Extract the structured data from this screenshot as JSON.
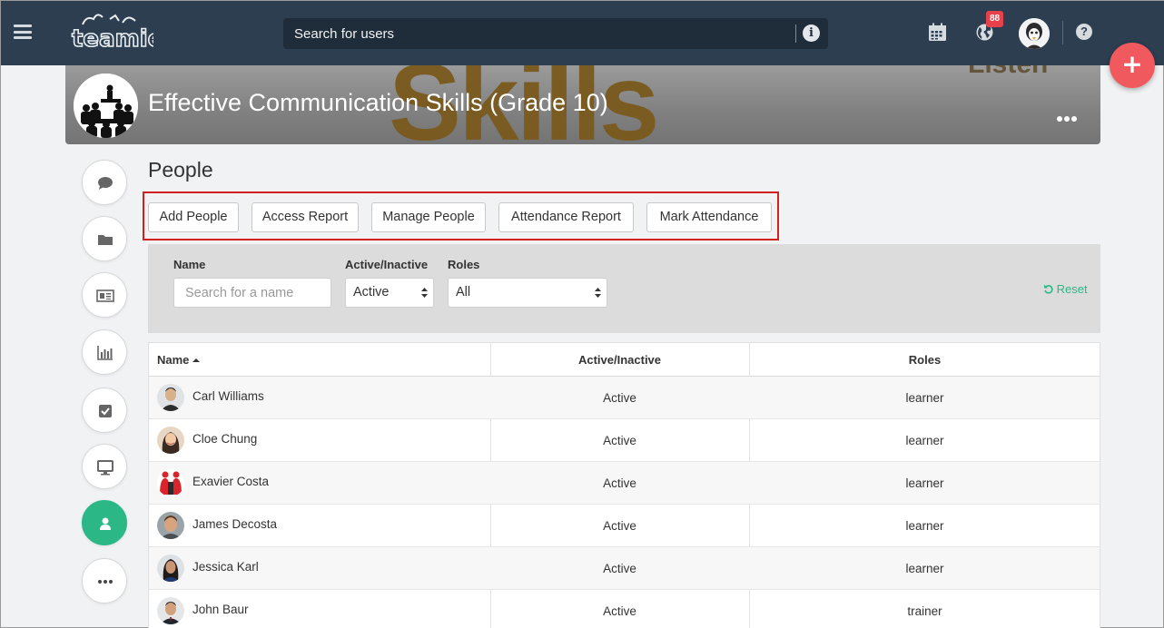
{
  "topbar": {
    "logo_text": "teamie",
    "search_placeholder": "Search for users",
    "notification_count": "88",
    "icons": [
      "hamburger-icon",
      "calendar-icon",
      "globe-icon",
      "info-icon",
      "help-icon",
      "plus-icon"
    ]
  },
  "banner": {
    "course_title": "Effective Communication Skills (Grade 10)",
    "bg_word": "Skills",
    "bg_word2": "Listen"
  },
  "sidebar": {
    "items": [
      {
        "name": "discussion",
        "icon": "chat-icon"
      },
      {
        "name": "files",
        "icon": "folder-icon"
      },
      {
        "name": "lessons",
        "icon": "newspaper-icon"
      },
      {
        "name": "gradebook",
        "icon": "bar-chart-icon"
      },
      {
        "name": "assessments",
        "icon": "checkbox-icon"
      },
      {
        "name": "classroom",
        "icon": "monitor-icon"
      },
      {
        "name": "people",
        "icon": "person-icon",
        "active": true
      },
      {
        "name": "more",
        "icon": "more-icon"
      }
    ]
  },
  "main": {
    "page_title": "People",
    "actions": [
      "Add People",
      "Access Report",
      "Manage People",
      "Attendance Report",
      "Mark Attendance"
    ],
    "filters": {
      "name_label": "Name",
      "name_placeholder": "Search for a name",
      "status_label": "Active/Inactive",
      "status_value": "Active",
      "roles_label": "Roles",
      "roles_value": "All",
      "reset_label": "Reset"
    },
    "table": {
      "columns": [
        "Name",
        "Active/Inactive",
        "Roles"
      ],
      "rows": [
        {
          "name": "Carl Williams",
          "status": "Active",
          "role": "learner"
        },
        {
          "name": "Cloe Chung",
          "status": "Active",
          "role": "learner"
        },
        {
          "name": "Exavier Costa",
          "status": "Active",
          "role": "learner"
        },
        {
          "name": "James Decosta",
          "status": "Active",
          "role": "learner"
        },
        {
          "name": "Jessica Karl",
          "status": "Active",
          "role": "learner"
        },
        {
          "name": "John Baur",
          "status": "Active",
          "role": "trainer"
        }
      ]
    }
  },
  "colors": {
    "topbar": "#2c3e50",
    "accent_green": "#2bb886",
    "fab_red": "#f05a5e",
    "highlight_red": "#d0211f",
    "badge_red": "#e8414b"
  }
}
